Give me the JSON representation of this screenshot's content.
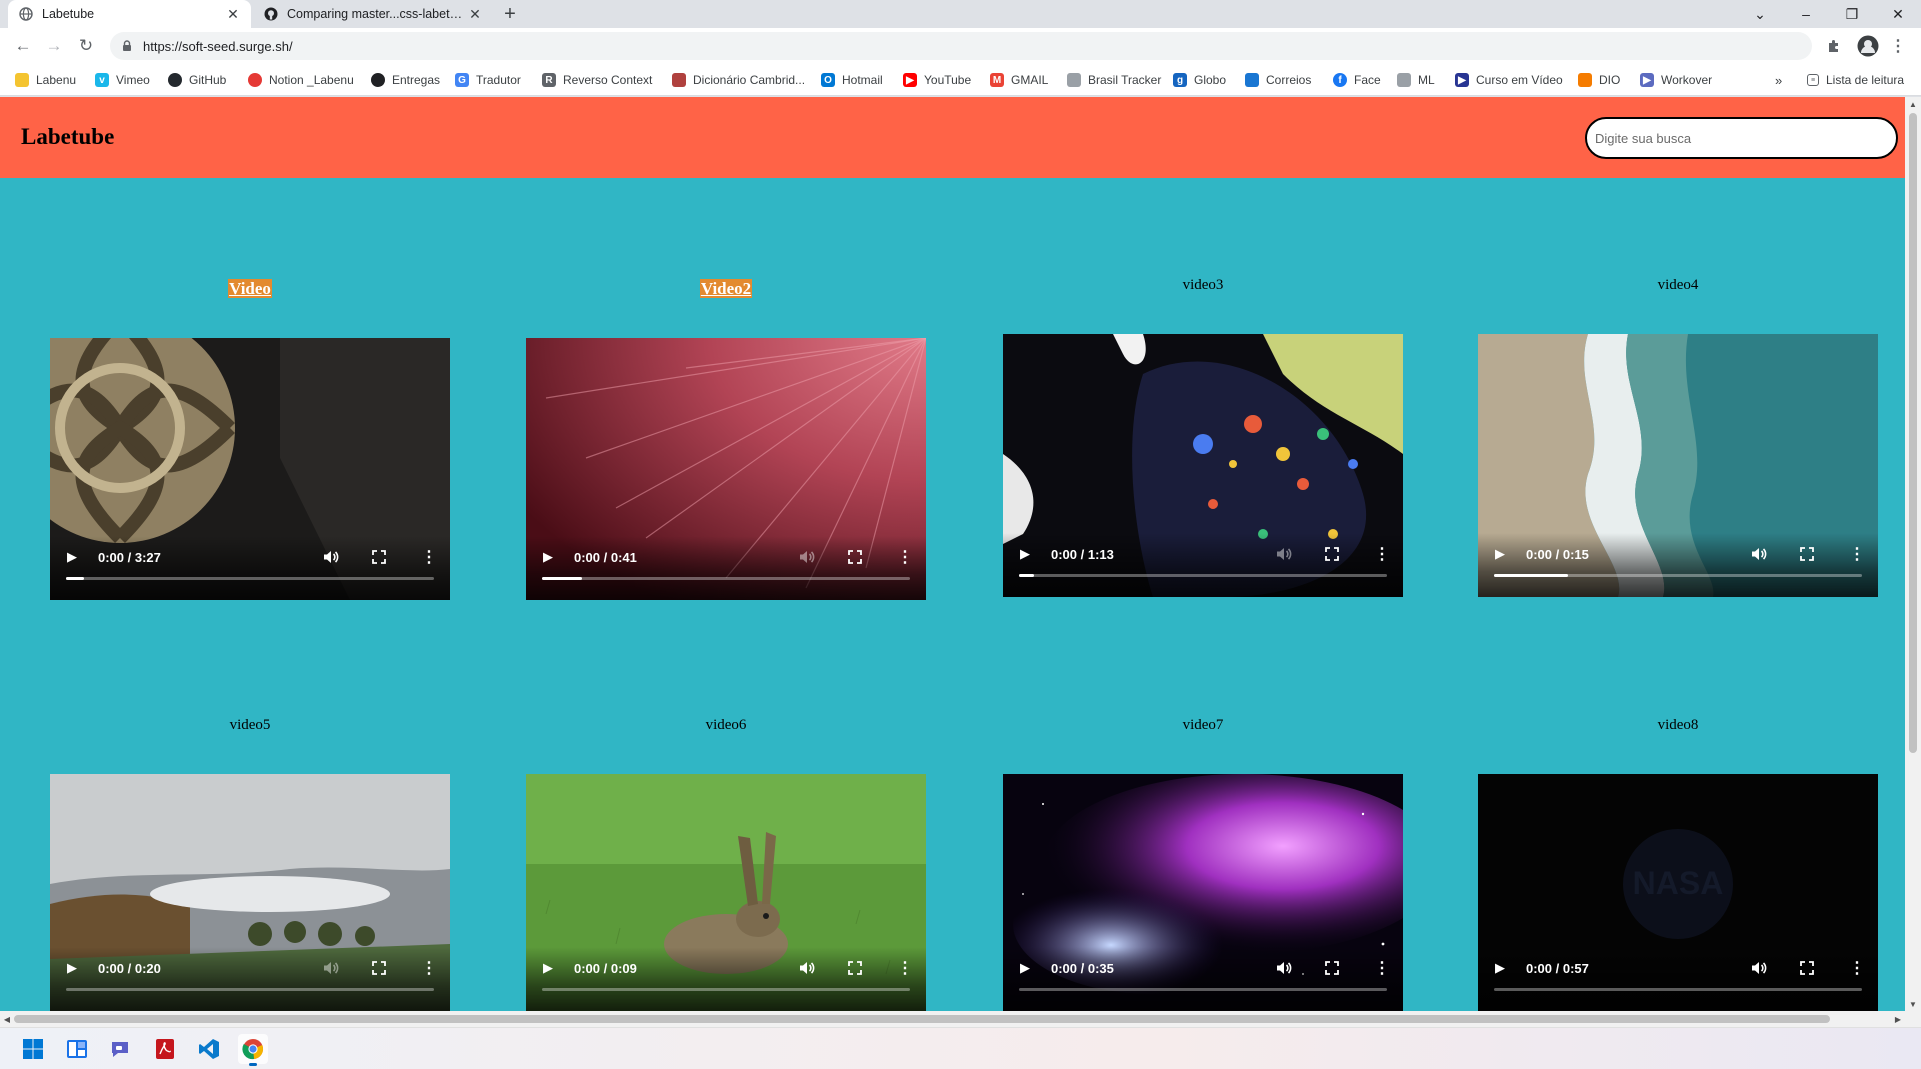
{
  "browser": {
    "tabs": [
      {
        "title": "Labetube",
        "active": true,
        "icon": "globe-icon"
      },
      {
        "title": "Comparing master...css-labetube",
        "active": false,
        "icon": "github-icon"
      }
    ],
    "url": "https://soft-seed.surge.sh/",
    "bookmarks": [
      {
        "label": "Labenu",
        "icon": "folder-icon",
        "color": "#f4c430"
      },
      {
        "label": "Vimeo",
        "icon": "vimeo-icon",
        "color": "#1ab7ea"
      },
      {
        "label": "GitHub",
        "icon": "github-icon",
        "color": "#24292e"
      },
      {
        "label": "Notion _Labenu",
        "icon": "apple-icon",
        "color": "#e53935"
      },
      {
        "label": "Entregas",
        "icon": "circle-icon",
        "color": "#202124"
      },
      {
        "label": "Tradutor",
        "icon": "translate-icon",
        "color": "#4285f4"
      },
      {
        "label": "Reverso Context",
        "icon": "reverso-icon",
        "color": "#5f6368"
      },
      {
        "label": "Dicionário Cambrid...",
        "icon": "shield-icon",
        "color": "#b0413e"
      },
      {
        "label": "Hotmail",
        "icon": "outlook-icon",
        "color": "#0078d4"
      },
      {
        "label": "YouTube",
        "icon": "youtube-icon",
        "color": "#ff0000"
      },
      {
        "label": "GMAIL",
        "icon": "gmail-icon",
        "color": "#ea4335"
      },
      {
        "label": "Brasil Tracker",
        "icon": "lock-icon",
        "color": "#9aa0a6"
      },
      {
        "label": "Globo",
        "icon": "globo-icon",
        "color": "#1565c0"
      },
      {
        "label": "Correios",
        "icon": "correios-icon",
        "color": "#1976d2"
      },
      {
        "label": "Face",
        "icon": "facebook-icon",
        "color": "#1877f2"
      },
      {
        "label": "ML",
        "icon": "ml-icon",
        "color": "#9aa0a6"
      },
      {
        "label": "Curso em Vídeo",
        "icon": "cursoemvideo-icon",
        "color": "#283593"
      },
      {
        "label": "DIO",
        "icon": "dio-icon",
        "color": "#f57c00"
      },
      {
        "label": "Workover",
        "icon": "workover-icon",
        "color": "#5c6bc0"
      }
    ],
    "reading_list": "Lista de leitura"
  },
  "site": {
    "logo": "Labetube",
    "search_placeholder": "Digite sua busca",
    "videos": [
      {
        "title": "Video",
        "highlighted": true,
        "time": "0:00 / 3:27",
        "progress": 0.05,
        "muted": false
      },
      {
        "title": "Video2",
        "highlighted": true,
        "time": "0:00 / 0:41",
        "progress": 0.11,
        "muted": true
      },
      {
        "title": "video3",
        "highlighted": false,
        "time": "0:00 / 1:13",
        "progress": 0.04,
        "muted": true
      },
      {
        "title": "video4",
        "highlighted": false,
        "time": "0:00 / 0:15",
        "progress": 0.2,
        "muted": false
      },
      {
        "title": "video5",
        "highlighted": false,
        "time": "0:00 / 0:20",
        "progress": 0,
        "muted": true
      },
      {
        "title": "video6",
        "highlighted": false,
        "time": "0:00 / 0:09",
        "progress": 0,
        "muted": false
      },
      {
        "title": "video7",
        "highlighted": false,
        "time": "0:00 / 0:35",
        "progress": 0,
        "muted": false
      },
      {
        "title": "video8",
        "highlighted": false,
        "time": "0:00 / 0:57",
        "progress": 0,
        "muted": false
      }
    ]
  },
  "colors": {
    "header": "#ff6347",
    "background": "#30b6c5",
    "title_highlight": "#e38a2f"
  }
}
